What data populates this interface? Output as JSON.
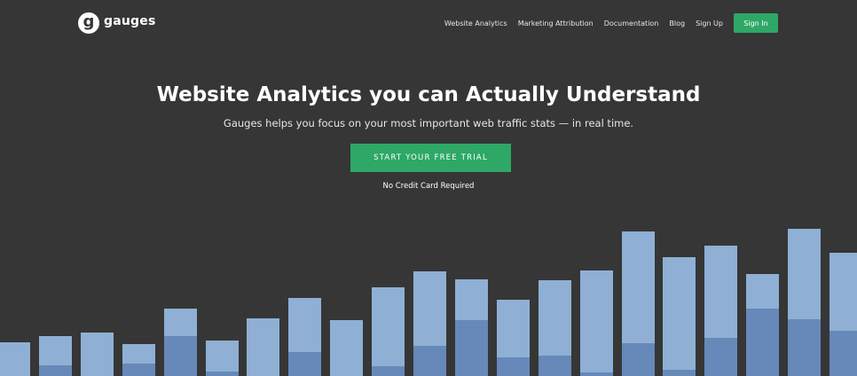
{
  "header": {
    "logo_glyph": "g",
    "logo_text": "gauges",
    "nav": [
      {
        "label": "Website Analytics"
      },
      {
        "label": "Marketing Attribution"
      },
      {
        "label": "Documentation"
      },
      {
        "label": "Blog"
      },
      {
        "label": "Sign Up"
      }
    ],
    "signin_label": "Sign In"
  },
  "hero": {
    "title": "Website Analytics you can Actually Understand",
    "subtitle": "Gauges helps you focus on your most important web traffic stats — in real time.",
    "cta_label": "START YOUR FREE TRIAL",
    "cta_note": "No Credit Card Required"
  },
  "colors": {
    "background": "#363636",
    "accent_green": "#2ea866",
    "bar_light": "#8fb0d4",
    "bar_dark": "#6689b9"
  },
  "decorative_bars": {
    "max": 166,
    "values": [
      {
        "total": 38,
        "part": 0
      },
      {
        "total": 45,
        "part": 12
      },
      {
        "total": 49,
        "part": 0
      },
      {
        "total": 36,
        "part": 14
      },
      {
        "total": 76,
        "part": 45
      },
      {
        "total": 40,
        "part": 5
      },
      {
        "total": 65,
        "part": 0
      },
      {
        "total": 88,
        "part": 27
      },
      {
        "total": 63,
        "part": 0
      },
      {
        "total": 100,
        "part": 11
      },
      {
        "total": 118,
        "part": 34
      },
      {
        "total": 109,
        "part": 63
      },
      {
        "total": 86,
        "part": 21
      },
      {
        "total": 108,
        "part": 23
      },
      {
        "total": 119,
        "part": 4
      },
      {
        "total": 163,
        "part": 37
      },
      {
        "total": 134,
        "part": 7
      },
      {
        "total": 147,
        "part": 43
      },
      {
        "total": 115,
        "part": 76
      },
      {
        "total": 166,
        "part": 64
      },
      {
        "total": 139,
        "part": 51
      }
    ]
  }
}
